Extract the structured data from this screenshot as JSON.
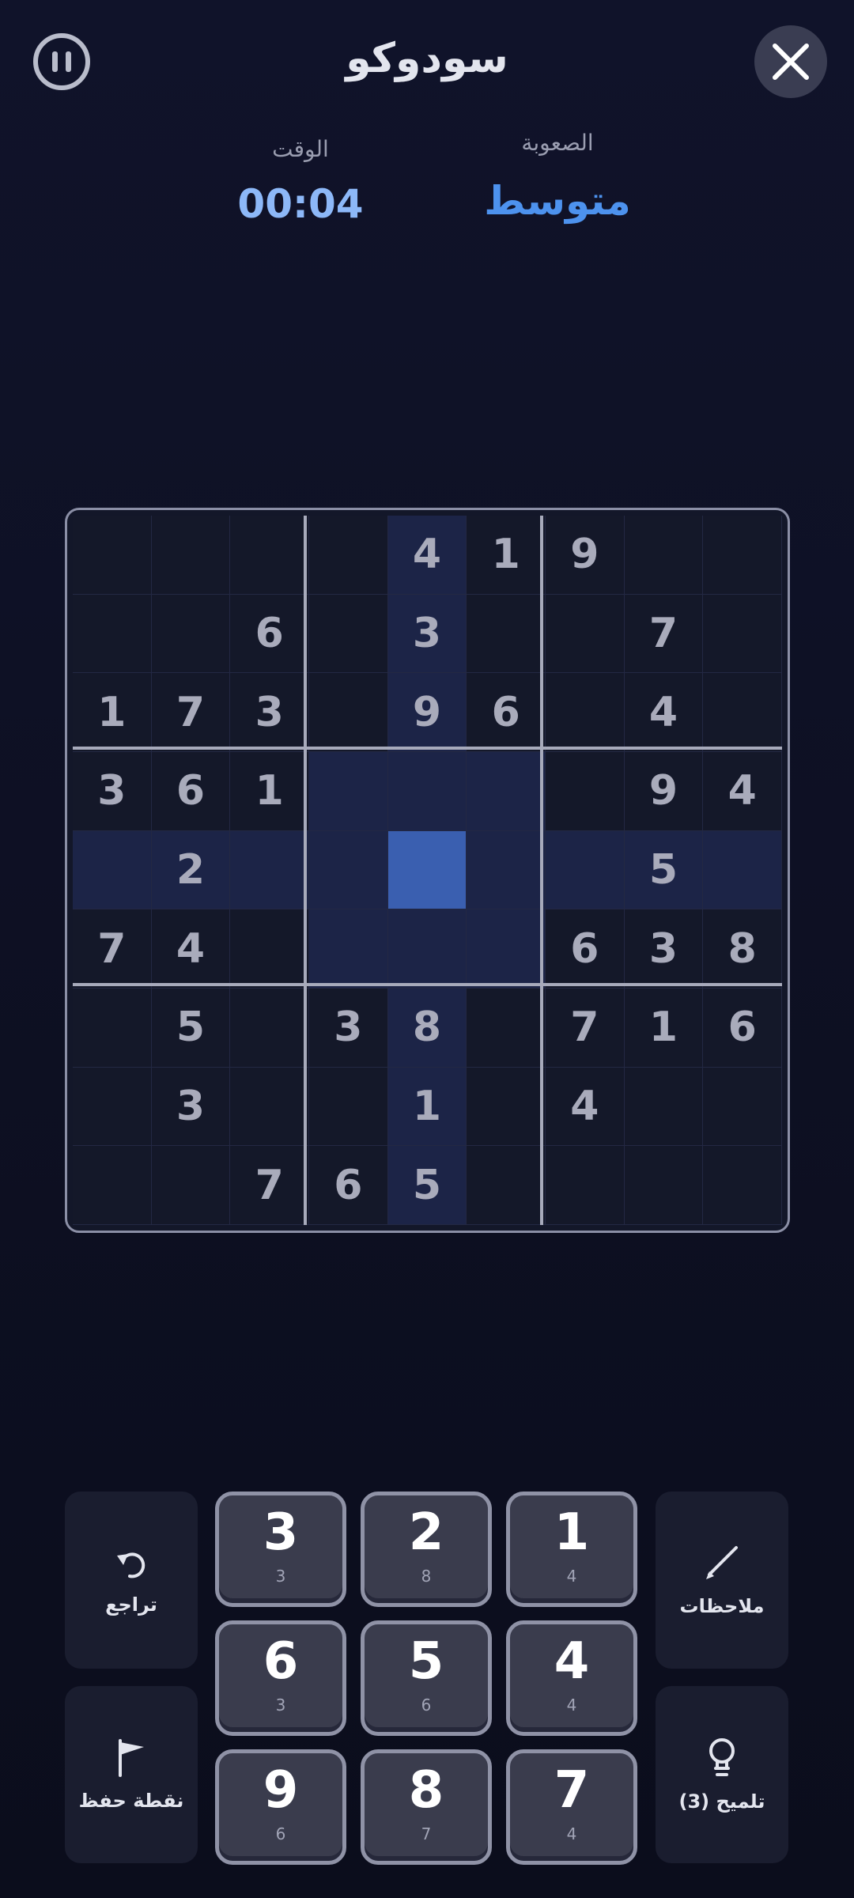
{
  "header": {
    "title": "سودوكو",
    "time_label": "الوقت",
    "time_value": "00:04",
    "difficulty_label": "الصعوبة",
    "difficulty_value": "متوسط"
  },
  "board": {
    "rows": [
      [
        "",
        "",
        "",
        "",
        "4",
        "1",
        "9",
        "",
        ""
      ],
      [
        "",
        "",
        "6",
        "",
        "3",
        "",
        "",
        "7",
        ""
      ],
      [
        "1",
        "7",
        "3",
        "",
        "9",
        "6",
        "",
        "4",
        ""
      ],
      [
        "3",
        "6",
        "1",
        "",
        "",
        "",
        "",
        "9",
        "4"
      ],
      [
        "",
        "2",
        "",
        "",
        "",
        "",
        "",
        "5",
        ""
      ],
      [
        "7",
        "4",
        "",
        "",
        "",
        "",
        "6",
        "3",
        "8"
      ],
      [
        "",
        "5",
        "",
        "3",
        "8",
        "",
        "7",
        "1",
        "6"
      ],
      [
        "",
        "3",
        "",
        "",
        "1",
        "",
        "4",
        "",
        ""
      ],
      [
        "",
        "",
        "7",
        "6",
        "5",
        "",
        "",
        "",
        ""
      ]
    ],
    "selected": [
      4,
      4
    ]
  },
  "controls": {
    "undo_label": "تراجع",
    "checkpoint_label": "نقطة حفظ",
    "notes_label": "ملاحظات",
    "hint_label": "تلميح (3)",
    "numpad": [
      {
        "n": "3",
        "c": "3"
      },
      {
        "n": "2",
        "c": "8"
      },
      {
        "n": "1",
        "c": "4"
      },
      {
        "n": "6",
        "c": "3"
      },
      {
        "n": "5",
        "c": "6"
      },
      {
        "n": "4",
        "c": "4"
      },
      {
        "n": "9",
        "c": "6"
      },
      {
        "n": "8",
        "c": "7"
      },
      {
        "n": "7",
        "c": "4"
      }
    ]
  },
  "colors": {
    "accent_time": "#8db8f8",
    "accent_difficulty": "#4d92ee",
    "selected_cell": "#3a5fb0",
    "highlight_cell": "#1c2447"
  }
}
